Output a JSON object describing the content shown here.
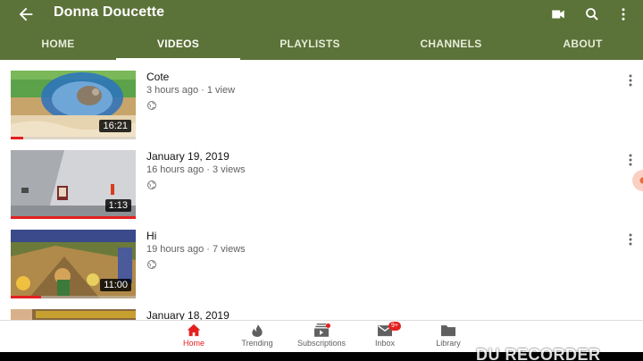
{
  "header": {
    "channel_name": "Donna Doucette",
    "icons": [
      "back-arrow-icon",
      "video-camera-icon",
      "search-icon",
      "more-vertical-icon"
    ],
    "color": "#5b7238"
  },
  "tabs": [
    {
      "label": "HOME",
      "active": false
    },
    {
      "label": "VIDEOS",
      "active": true
    },
    {
      "label": "PLAYLISTS",
      "active": false
    },
    {
      "label": "CHANNELS",
      "active": false
    },
    {
      "label": "ABOUT",
      "active": false
    }
  ],
  "videos": [
    {
      "title": "Cote",
      "meta": "3 hours ago · 1 view",
      "duration": "16:21",
      "watched_fraction": 0.1
    },
    {
      "title": "January 19, 2019",
      "meta": "16 hours ago · 3 views",
      "duration": "1:13",
      "watched_fraction": 1.0
    },
    {
      "title": "Hi",
      "meta": "19 hours ago · 7 views",
      "duration": "11:00",
      "watched_fraction": 0.24
    },
    {
      "title": "January 18, 2019",
      "meta": "",
      "duration": "",
      "watched_fraction": 0
    }
  ],
  "bottom_nav": [
    {
      "label": "Home",
      "icon": "home-icon",
      "active": true
    },
    {
      "label": "Trending",
      "icon": "flame-icon",
      "active": false
    },
    {
      "label": "Subscriptions",
      "icon": "subscriptions-icon",
      "active": false,
      "dot": true
    },
    {
      "label": "Inbox",
      "icon": "inbox-icon",
      "active": false,
      "badge": "9+"
    },
    {
      "label": "Library",
      "icon": "folder-icon",
      "active": false
    }
  ],
  "watermark": "DU RECORDER",
  "accent_color": "#e52020"
}
